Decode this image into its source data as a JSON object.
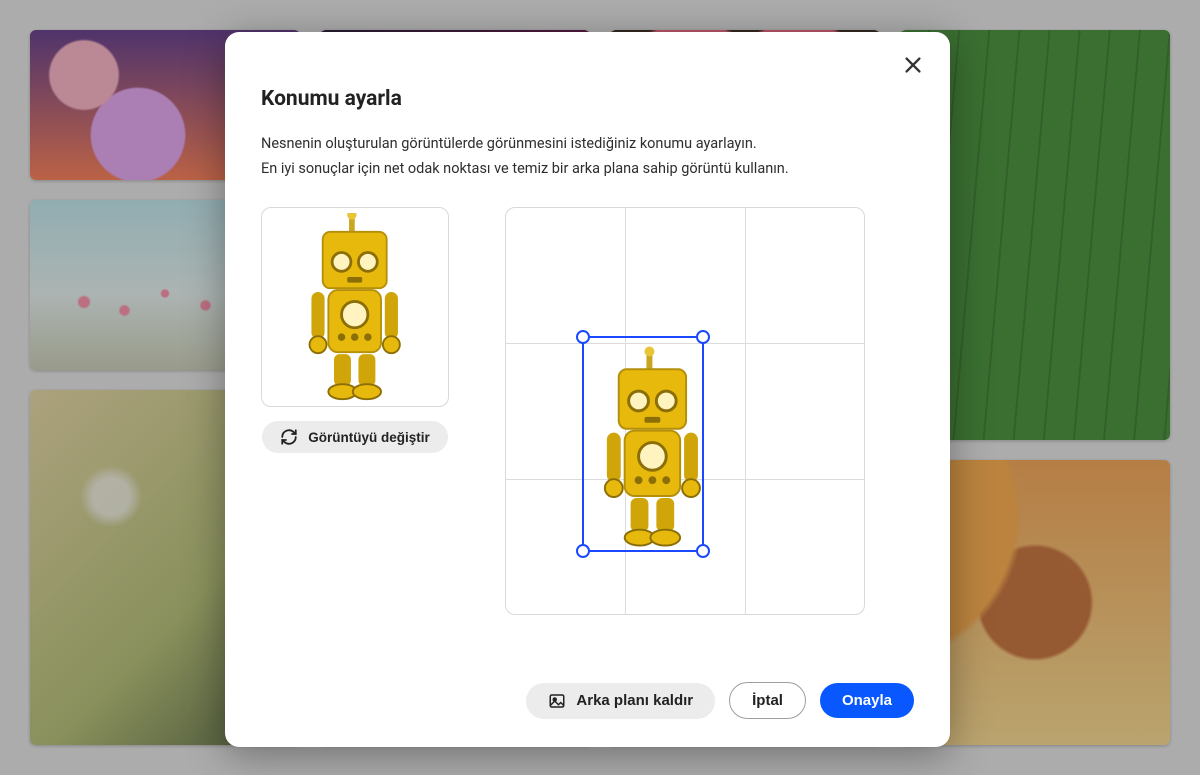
{
  "modal": {
    "title": "Konumu ayarla",
    "subtitle": "Nesnenin oluşturulan görüntülerde görünmesini istediğiniz konumu ayarlayın.",
    "hint": "En iyi sonuçlar için net odak noktası ve temiz bir arka plana sahip görüntü kullanın.",
    "switch_image_label": "Görüntüyü değiştir",
    "remove_bg_label": "Arka planı kaldır",
    "cancel_label": "İptal",
    "confirm_label": "Onayla"
  },
  "preview": {
    "subject": "yellow-toy-robot"
  },
  "placement_grid": {
    "columns": 3,
    "rows": 3,
    "selection": {
      "col_pct": 33,
      "row_pct": 40,
      "width_pct": 34,
      "height_pct": 53
    }
  },
  "colors": {
    "accent": "#0857ff",
    "selection": "#1c49ff"
  }
}
